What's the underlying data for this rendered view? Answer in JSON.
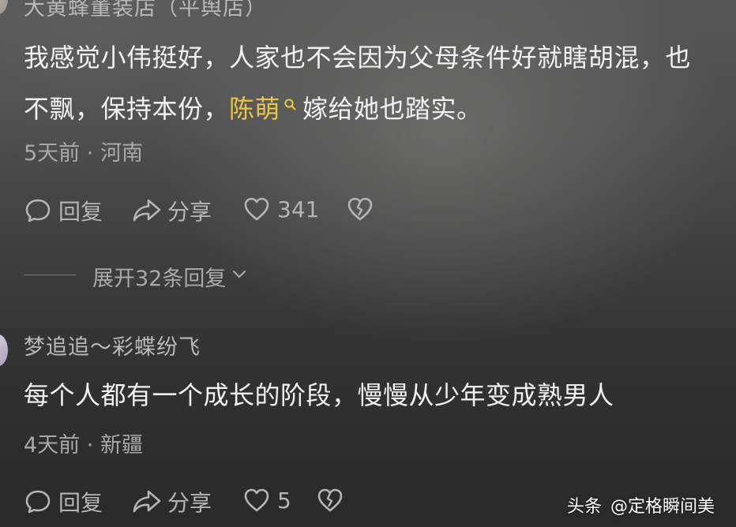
{
  "comment1": {
    "username": "大黄蜂董装店（平舆店）",
    "text_line1": "我感觉小伟挺好，人家也不会因为父母条件好就瞎胡混，也",
    "text_line2_before": "不飘，保持本份，",
    "text_link": "陈萌",
    "text_line2_after": "嫁给她也踏实。",
    "time": "5天前",
    "location": "河南",
    "reply_label": "回复",
    "share_label": "分享",
    "like_count": "341"
  },
  "expand_replies_label": "展开32条回复",
  "comment2": {
    "username": "梦追追～彩蝶纷飞",
    "text": "每个人都有一个成长的阶段，慢慢从少年变成熟男人",
    "time": "4天前",
    "location": "新疆",
    "reply_label": "回复",
    "share_label": "分享",
    "like_count": "5"
  },
  "watermark": {
    "platform": "头条",
    "account": "@定格瞬间美"
  },
  "icons": {
    "reply": "speech-bubble-icon",
    "share": "share-arrow-icon",
    "like": "heart-icon",
    "dislike": "broken-heart-icon",
    "search": "search-icon",
    "expand": "chevron-down-icon"
  },
  "colors": {
    "highlight": "#e6c54a",
    "text_primary": "#f1f1f1",
    "text_secondary": "#a9a9a9"
  }
}
